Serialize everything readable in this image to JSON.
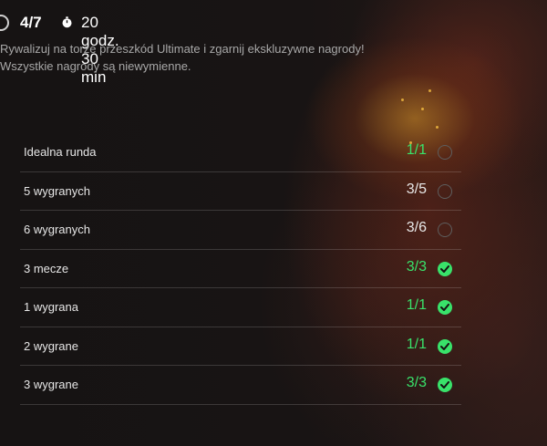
{
  "header": {
    "progress": "4/7",
    "timer": "20 godz. 30 min"
  },
  "description": {
    "line1": "Rywalizuj na torze przeszkód Ultimate i zgarnij ekskluzywne nagrody!",
    "line2": "Wszystkie nagrody są niewymienne."
  },
  "colors": {
    "complete": "#39e26a",
    "text": "#e6e6e6",
    "muted": "#a8a8a8"
  },
  "challenges": [
    {
      "label": "Idealna runda",
      "count": "1/1",
      "state": "pending",
      "count_color": "green"
    },
    {
      "label": "5 wygranych",
      "count": "3/5",
      "state": "pending",
      "count_color": "white"
    },
    {
      "label": "6 wygranych",
      "count": "3/6",
      "state": "pending",
      "count_color": "white"
    },
    {
      "label": "3 mecze",
      "count": "3/3",
      "state": "complete",
      "count_color": "green"
    },
    {
      "label": "1 wygrana",
      "count": "1/1",
      "state": "complete",
      "count_color": "green"
    },
    {
      "label": "2 wygrane",
      "count": "1/1",
      "state": "complete",
      "count_color": "green"
    },
    {
      "label": "3 wygrane",
      "count": "3/3",
      "state": "complete",
      "count_color": "green"
    }
  ]
}
